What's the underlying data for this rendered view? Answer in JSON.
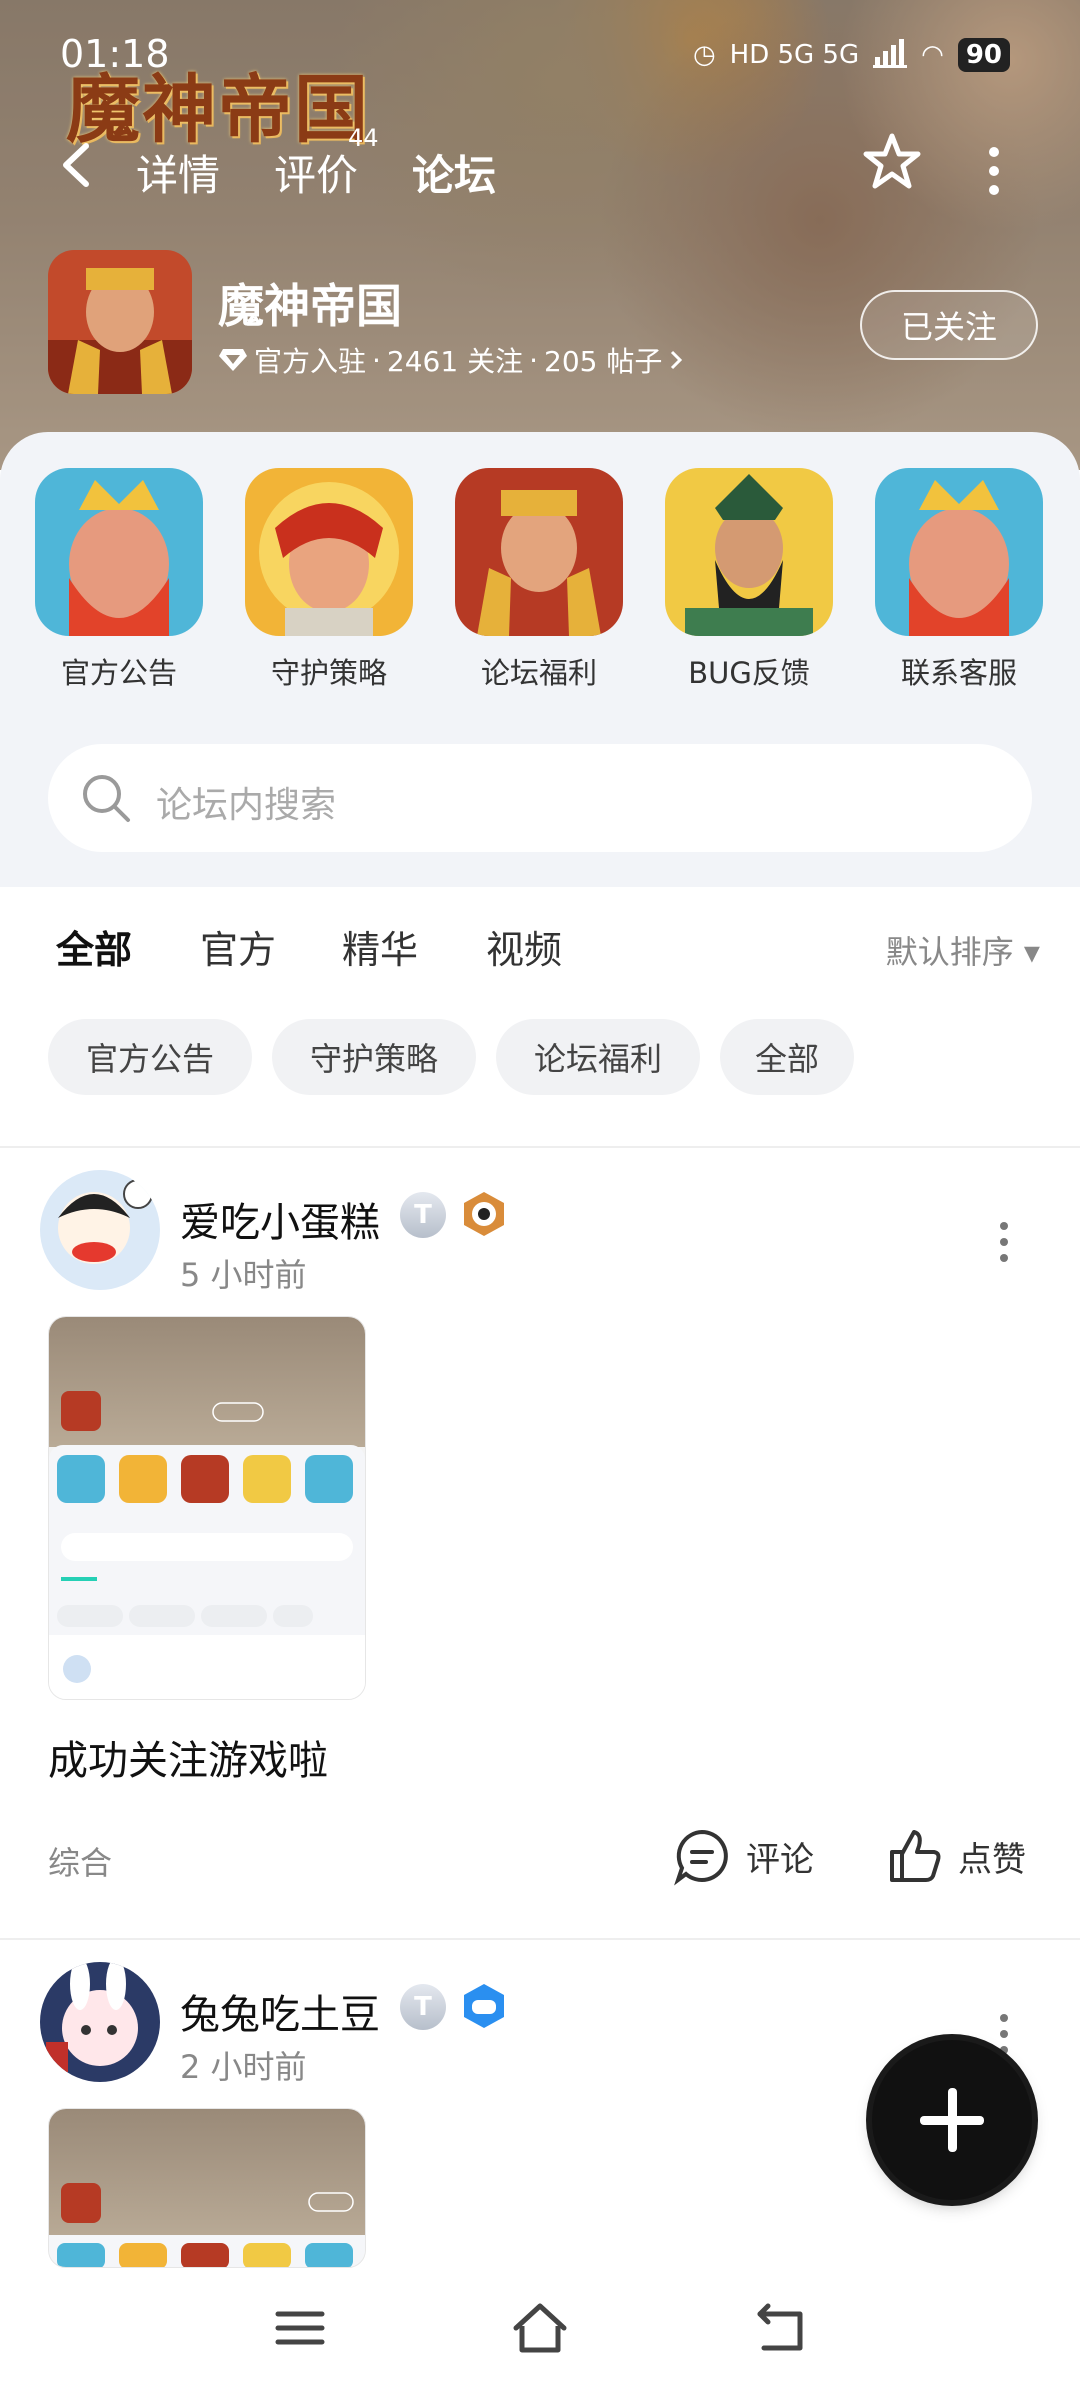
{
  "status_bar": {
    "time": "01:18",
    "network": "HD 5G 5G",
    "battery": "90"
  },
  "header": {
    "game_logo": "魔神帝国",
    "tabs": [
      {
        "label": "详情"
      },
      {
        "label": "评价",
        "badge": "44"
      },
      {
        "label": "论坛",
        "active": true
      }
    ]
  },
  "game": {
    "name": "魔神帝国",
    "verified": "官方入驻",
    "sep1": "·",
    "followers": "2461 关注",
    "sep2": "·",
    "posts": "205 帖子",
    "follow_button": "已关注"
  },
  "shortcuts": [
    {
      "label": "官方公告"
    },
    {
      "label": "守护策略"
    },
    {
      "label": "论坛福利"
    },
    {
      "label": "BUG反馈"
    },
    {
      "label": "联系客服"
    }
  ],
  "search": {
    "placeholder": "论坛内搜索"
  },
  "filter_tabs": [
    {
      "label": "全部",
      "active": true
    },
    {
      "label": "官方"
    },
    {
      "label": "精华"
    },
    {
      "label": "视频"
    }
  ],
  "sort": {
    "label": "默认排序 ▾"
  },
  "chips": [
    {
      "label": "官方公告"
    },
    {
      "label": "守护策略"
    },
    {
      "label": "论坛福利"
    },
    {
      "label": "全部"
    }
  ],
  "posts": [
    {
      "user": "爱吃小蛋糕",
      "level": "T",
      "time": "5 小时前",
      "text": "成功关注游戏啦",
      "category": "综合",
      "comment_label": "评论",
      "like_label": "点赞"
    },
    {
      "user": "兔兔吃土豆",
      "level": "T",
      "time": "2 小时前"
    }
  ],
  "colors": {
    "accent": "#25d0b5",
    "text_muted": "#888888"
  }
}
